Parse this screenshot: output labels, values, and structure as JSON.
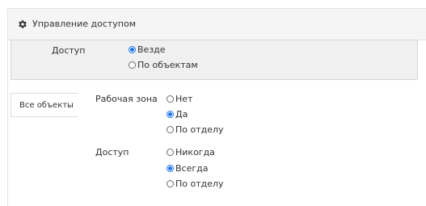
{
  "panel": {
    "title": "Управление доступом",
    "icon": "gear-icon"
  },
  "access": {
    "label": "Доступ",
    "options": [
      {
        "label": "Везде",
        "checked": true
      },
      {
        "label": "По объектам",
        "checked": false
      }
    ]
  },
  "tabs": [
    {
      "label": "Все объекты",
      "active": true
    }
  ],
  "settings": {
    "workzone": {
      "label": "Рабочая зона",
      "options": [
        {
          "label": "Нет",
          "checked": false
        },
        {
          "label": "Да",
          "checked": true
        },
        {
          "label": "По отделу",
          "checked": false
        }
      ]
    },
    "access": {
      "label": "Доступ",
      "options": [
        {
          "label": "Никогда",
          "checked": false
        },
        {
          "label": "Всегда",
          "checked": true
        },
        {
          "label": "По отделу",
          "checked": false
        }
      ]
    }
  },
  "colors": {
    "accent": "#1a73e8",
    "header_bg": "#f5f5f5",
    "box_bg": "#f0f0f0"
  }
}
